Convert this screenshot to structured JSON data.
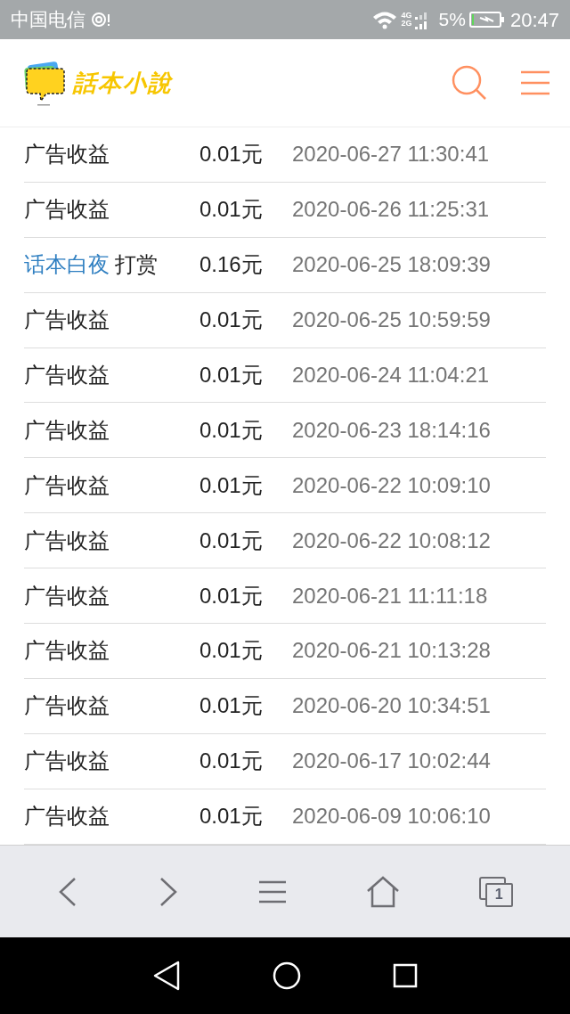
{
  "status_bar": {
    "carrier": "中国电信",
    "network_top": "4G",
    "network_bottom": "2G",
    "battery": "5%",
    "time": "20:47"
  },
  "header": {
    "logo_text": "話本小說"
  },
  "records": [
    {
      "kind": "plain",
      "name": "广告收益",
      "amount": "0.01元",
      "time": "2020-06-27 11:30:41"
    },
    {
      "kind": "plain",
      "name": "广告收益",
      "amount": "0.01元",
      "time": "2020-06-26 11:25:31"
    },
    {
      "kind": "reward",
      "user": "话本白夜",
      "name": "打赏",
      "amount": "0.16元",
      "time": "2020-06-25 18:09:39"
    },
    {
      "kind": "plain",
      "name": "广告收益",
      "amount": "0.01元",
      "time": "2020-06-25 10:59:59"
    },
    {
      "kind": "plain",
      "name": "广告收益",
      "amount": "0.01元",
      "time": "2020-06-24 11:04:21"
    },
    {
      "kind": "plain",
      "name": "广告收益",
      "amount": "0.01元",
      "time": "2020-06-23 18:14:16"
    },
    {
      "kind": "plain",
      "name": "广告收益",
      "amount": "0.01元",
      "time": "2020-06-22 10:09:10"
    },
    {
      "kind": "plain",
      "name": "广告收益",
      "amount": "0.01元",
      "time": "2020-06-22 10:08:12"
    },
    {
      "kind": "plain",
      "name": "广告收益",
      "amount": "0.01元",
      "time": "2020-06-21 11:11:18"
    },
    {
      "kind": "plain",
      "name": "广告收益",
      "amount": "0.01元",
      "time": "2020-06-21 10:13:28"
    },
    {
      "kind": "plain",
      "name": "广告收益",
      "amount": "0.01元",
      "time": "2020-06-20 10:34:51"
    },
    {
      "kind": "plain",
      "name": "广告收益",
      "amount": "0.01元",
      "time": "2020-06-17 10:02:44"
    },
    {
      "kind": "plain",
      "name": "广告收益",
      "amount": "0.01元",
      "time": "2020-06-09 10:06:10"
    }
  ],
  "browser_bar": {
    "tab_count": "1"
  }
}
